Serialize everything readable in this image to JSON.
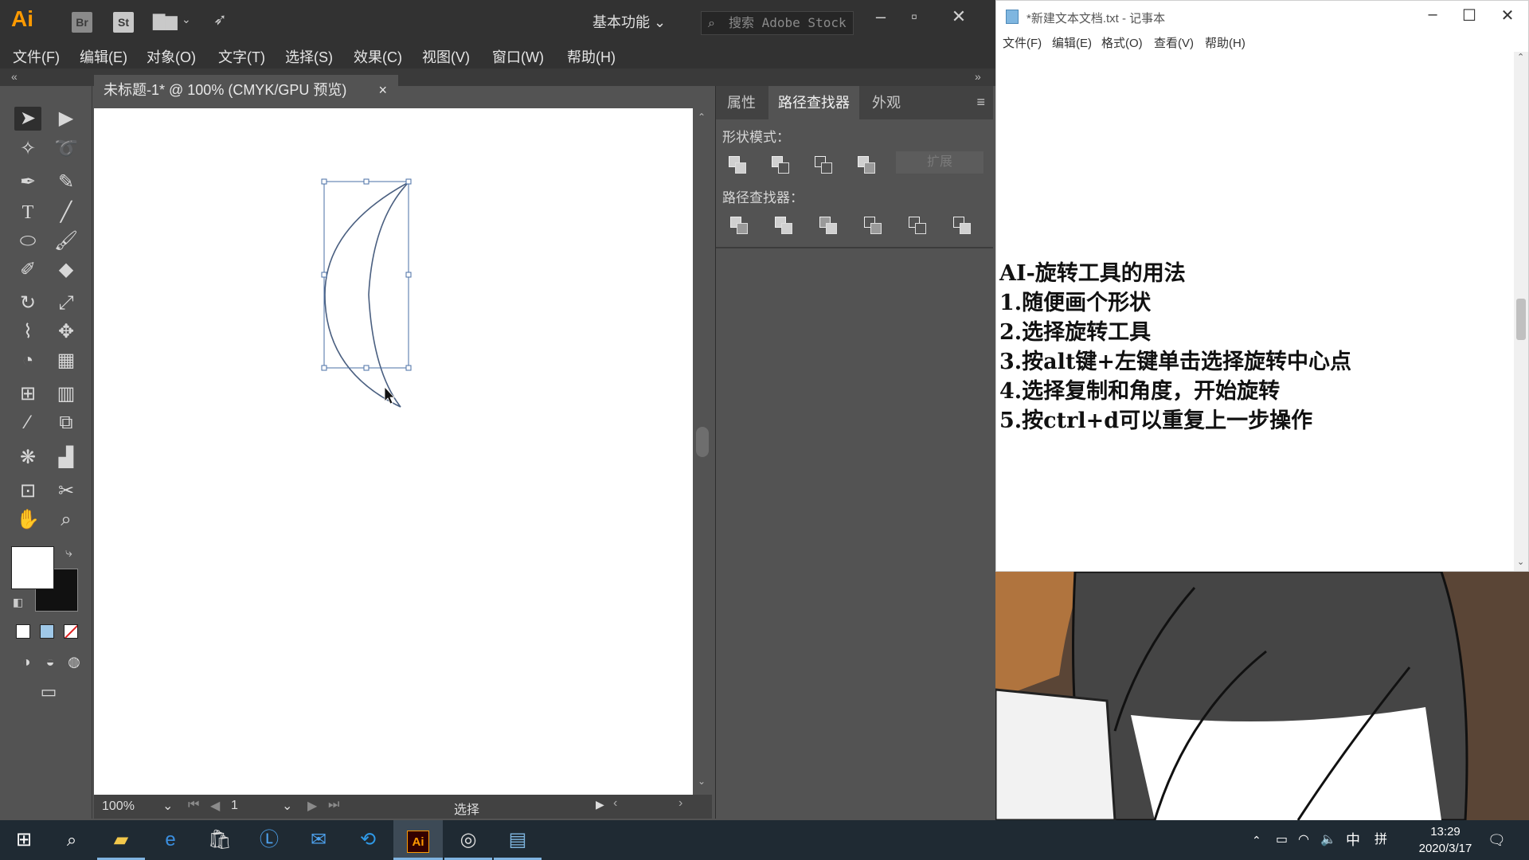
{
  "illustrator": {
    "logo": "Ai",
    "bridge_label": "Br",
    "stock_app_label": "St",
    "workspace_label": "基本功能",
    "stock_search_placeholder": "搜索 Adobe Stock",
    "menus": [
      "文件(F)",
      "编辑(E)",
      "对象(O)",
      "文字(T)",
      "选择(S)",
      "效果(C)",
      "视图(V)",
      "窗口(W)",
      "帮助(H)"
    ],
    "document_tab": "未标题-1* @ 100% (CMYK/GPU 预览)",
    "document_tab_close": "×",
    "status": {
      "zoom": "100%",
      "artboard_number": "1",
      "current_tool": "选择"
    },
    "panel": {
      "tabs": [
        "属性",
        "路径查找器",
        "外观"
      ],
      "active_tab": "路径查找器",
      "shape_modes_label": "形状模式：",
      "expand_label": "扩展",
      "pathfinders_label": "路径查找器："
    },
    "colors": {
      "brand": "#ff9a00",
      "selection_stroke": "#4a6fa5",
      "shape_stroke": "#4a5f80"
    }
  },
  "notepad": {
    "title": "*新建文本文档.txt - 记事本",
    "menus": [
      "文件(F)",
      "编辑(E)",
      "格式(O)",
      "查看(V)",
      "帮助(H)"
    ],
    "lines": [
      "AI-旋转工具的用法",
      "1.随便画个形状",
      "2.选择旋转工具",
      "3.按alt键+左键单击选择旋转中心点",
      "4.选择复制和角度，开始旋转",
      "5.按ctrl+d可以重复上一步操作"
    ]
  },
  "taskbar": {
    "ime_mode": "中",
    "ime_layout": "拼",
    "time": "13:29",
    "date": "2020/3/17"
  }
}
